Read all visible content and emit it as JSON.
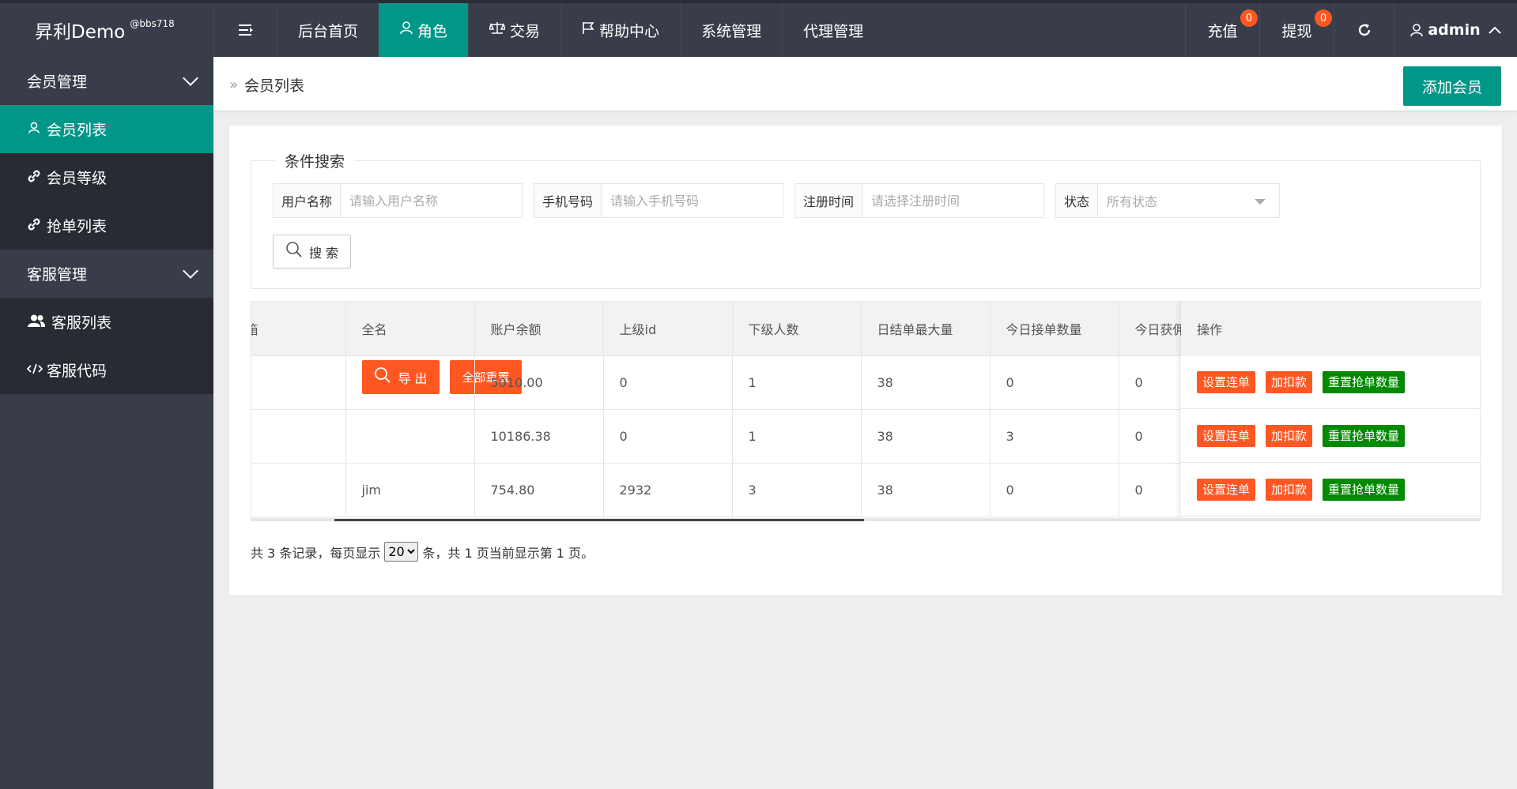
{
  "header": {
    "logo": "昇利Demo",
    "logo_sup": "@bbs718",
    "nav": [
      {
        "label": "后台首页",
        "icon": ""
      },
      {
        "label": "角色",
        "icon": "user-icon",
        "active": true
      },
      {
        "label": "交易",
        "icon": "scale-icon"
      },
      {
        "label": "帮助中心",
        "icon": "flag-icon"
      },
      {
        "label": "系统管理",
        "icon": ""
      },
      {
        "label": "代理管理",
        "icon": ""
      }
    ],
    "recharge": {
      "label": "充值",
      "badge": "0"
    },
    "withdraw": {
      "label": "提现",
      "badge": "0"
    },
    "user": "admin"
  },
  "sidebar": {
    "groups": [
      {
        "label": "会员管理",
        "items": [
          {
            "label": "会员列表",
            "icon": "user-icon",
            "active": true
          },
          {
            "label": "会员等级",
            "icon": "link-icon"
          },
          {
            "label": "抢单列表",
            "icon": "link-icon"
          }
        ]
      },
      {
        "label": "客服管理",
        "items": [
          {
            "label": "客服列表",
            "icon": "users-icon"
          },
          {
            "label": "客服代码",
            "icon": "code-icon"
          }
        ]
      }
    ]
  },
  "breadcrumb": {
    "current": "会员列表"
  },
  "add_button": "添加会员",
  "search": {
    "legend": "条件搜索",
    "username": {
      "label": "用户名称",
      "placeholder": "请输入用户名称"
    },
    "phone": {
      "label": "手机号码",
      "placeholder": "请输入手机号码"
    },
    "regtime": {
      "label": "注册时间",
      "placeholder": "请选择注册时间"
    },
    "status": {
      "label": "状态",
      "value": "所有状态"
    },
    "search_btn": "搜 索",
    "export_btn": "导 出",
    "reset_btn": "全部重置"
  },
  "table": {
    "columns": [
      "箱",
      "全名",
      "账户余额",
      "上级id",
      "下级人数",
      "日结单最大量",
      "今日接单数量",
      "今日获佣"
    ],
    "ops_header": "操作",
    "rows": [
      {
        "c0": "",
        "fullname": "",
        "balance": "5010.00",
        "parent_id": "0",
        "sub_count": "1",
        "daily_max": "38",
        "today_orders": "0",
        "today_comm": "0"
      },
      {
        "c0": "",
        "fullname": "",
        "balance": "10186.38",
        "parent_id": "0",
        "sub_count": "1",
        "daily_max": "38",
        "today_orders": "3",
        "today_comm": "0"
      },
      {
        "c0": "",
        "fullname": "jim",
        "balance": "754.80",
        "parent_id": "2932",
        "sub_count": "3",
        "daily_max": "38",
        "today_orders": "0",
        "today_comm": "0"
      }
    ],
    "ops": {
      "set_chain": "设置连单",
      "adjust": "加扣款",
      "reset_count": "重置抢单数量"
    }
  },
  "pager": {
    "prefix": "共 3 条记录，每页显示",
    "page_size": "20",
    "suffix": "条，共 1 页当前显示第 1 页。"
  }
}
